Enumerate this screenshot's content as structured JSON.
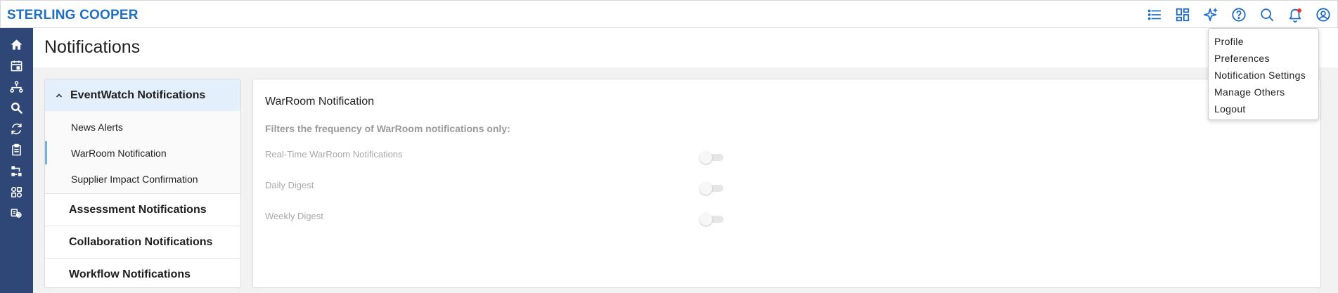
{
  "app": {
    "brand": "STERLING COOPER"
  },
  "topbar": {
    "icons": [
      "list-icon",
      "dashboard-icon",
      "sparkle-icon",
      "help-icon",
      "search-icon",
      "bell-icon",
      "user-icon"
    ]
  },
  "rail": {
    "icons": [
      "home-icon",
      "calendar-icon",
      "hierarchy-icon",
      "search-zoom-icon",
      "refresh-icon",
      "clipboard-icon",
      "workflow-icon",
      "grid-apps-icon",
      "settings-gear-icon"
    ]
  },
  "page": {
    "title": "Notifications"
  },
  "sidebar": {
    "expanded_group": {
      "label": "EventWatch Notifications",
      "items": [
        {
          "label": "News Alerts",
          "active": false
        },
        {
          "label": "WarRoom Notification",
          "active": true
        },
        {
          "label": "Supplier Impact Confirmation",
          "active": false
        }
      ]
    },
    "collapsed_groups": [
      {
        "label": "Assessment Notifications"
      },
      {
        "label": "Collaboration Notifications"
      },
      {
        "label": "Workflow Notifications"
      }
    ]
  },
  "main": {
    "title": "WarRoom Notification",
    "description": "Filters the frequency of WarRoom notifications only:",
    "settings": [
      {
        "label": "Real-Time WarRoom Notifications",
        "enabled": false
      },
      {
        "label": "Daily Digest",
        "enabled": false
      },
      {
        "label": "Weekly Digest",
        "enabled": false
      }
    ]
  },
  "user_menu": {
    "items": [
      {
        "label": "Profile"
      },
      {
        "label": "Preferences"
      },
      {
        "label": "Notification Settings"
      },
      {
        "label": "Manage Others"
      },
      {
        "label": "Logout"
      }
    ]
  },
  "colors": {
    "brand": "#1f6fc5",
    "rail": "#2f4777",
    "expanded_header_bg": "#e3effb",
    "active_indicator": "#7ab0e0",
    "notification_dot": "#e53935"
  }
}
